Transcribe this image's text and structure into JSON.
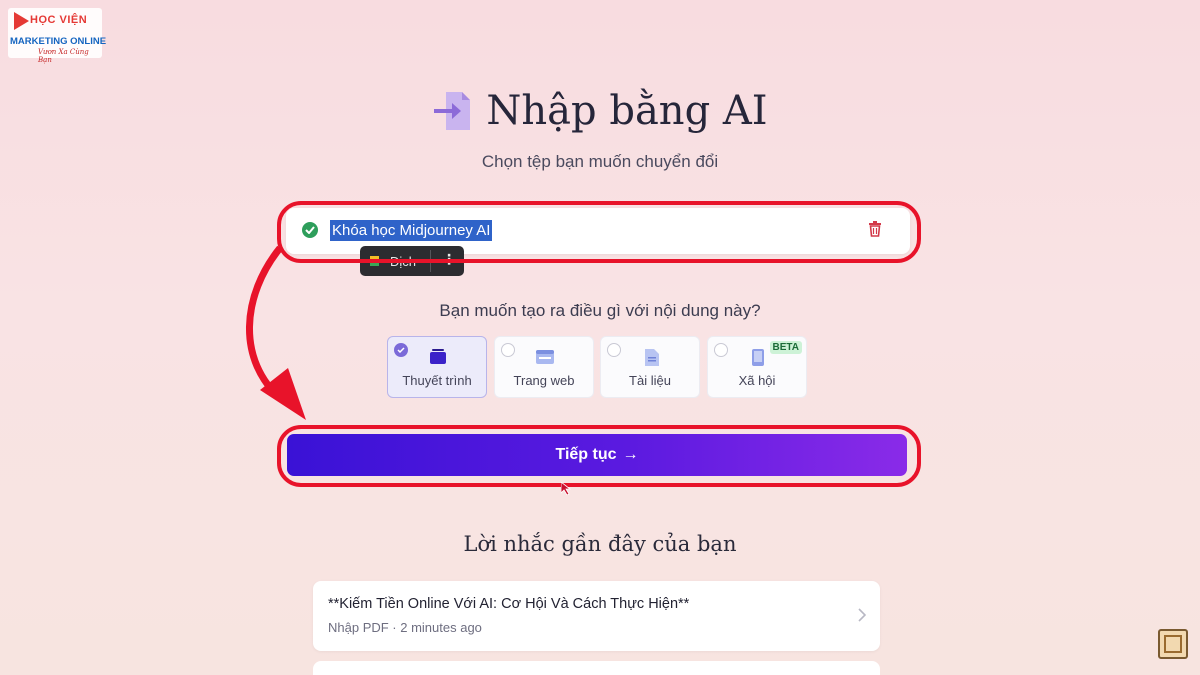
{
  "logo": {
    "line1": "HỌC VIỆN",
    "line2": "MARKETING ONLINE",
    "line3": "Vươn Xa Cùng Bạn"
  },
  "header": {
    "title": "Nhập bằng AI",
    "subtitle": "Chọn tệp bạn muốn chuyển đổi",
    "icon": "document-import-icon"
  },
  "file": {
    "name": "Khóa học Midjourney AI",
    "status_icon": "check-circle-icon",
    "delete_icon": "trash-icon"
  },
  "translate_popup": {
    "label": "Dịch",
    "more": "⋮"
  },
  "question": "Bạn muốn tạo ra điều gì với nội dung này?",
  "options": [
    {
      "label": "Thuyết trình",
      "icon": "presentation-icon",
      "selected": true
    },
    {
      "label": "Trang web",
      "icon": "webpage-icon",
      "selected": false
    },
    {
      "label": "Tài liệu",
      "icon": "document-icon",
      "selected": false
    },
    {
      "label": "Xã hội",
      "icon": "phone-icon",
      "selected": false,
      "badge": "BETA"
    }
  ],
  "continue_button": {
    "label": "Tiếp tục",
    "arrow": "→"
  },
  "recent": {
    "title": "Lời nhắc gần đây của bạn",
    "items": [
      {
        "title": "**Kiếm Tiền Online Với AI: Cơ Hội Và Cách Thực Hiện**",
        "meta": "Nhập PDF · 2 minutes ago"
      }
    ]
  },
  "colors": {
    "accent": "#5b1ae0",
    "annotation": "#e8132a",
    "selected_option": "#ecebfa"
  }
}
